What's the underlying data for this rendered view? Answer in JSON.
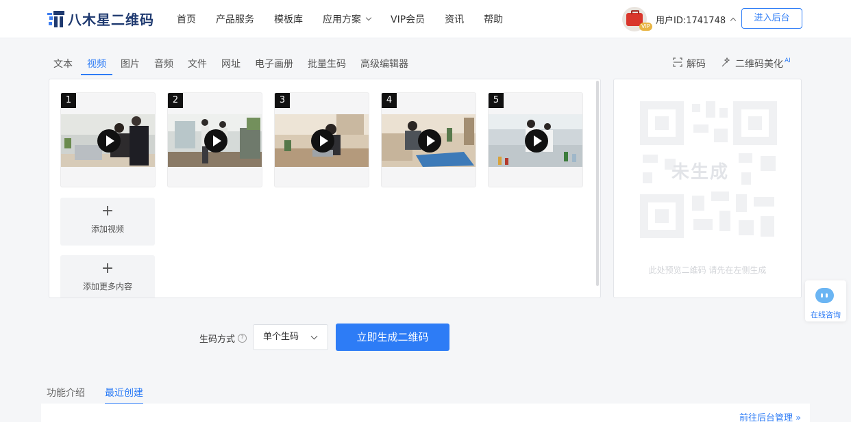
{
  "header": {
    "logo_text": "八木星二维码",
    "nav": [
      {
        "label": "首页"
      },
      {
        "label": "产品服务"
      },
      {
        "label": "模板库"
      },
      {
        "label": "应用方案",
        "has_dropdown": true
      },
      {
        "label": "VIP会员"
      },
      {
        "label": "资讯"
      },
      {
        "label": "帮助"
      }
    ],
    "user": {
      "vip_badge": "VIP",
      "id_text": "用户ID:1741748"
    },
    "enter_button": "进入后台"
  },
  "content_tabs": {
    "items": [
      "文本",
      "视频",
      "图片",
      "音频",
      "文件",
      "网址",
      "电子画册",
      "批量生码",
      "高级编辑器"
    ],
    "active": "视频"
  },
  "tools": {
    "decode_label": "解码",
    "beautify_label": "二维码美化",
    "beautify_badge": "AI"
  },
  "videos": [
    {
      "number": "1",
      "scene": "office-two-people-laptop"
    },
    {
      "number": "2",
      "scene": "office-walking"
    },
    {
      "number": "3",
      "scene": "sofa-laptop"
    },
    {
      "number": "4",
      "scene": "meeting-table"
    },
    {
      "number": "5",
      "scene": "laboratory"
    }
  ],
  "add_video_label": "添加视频",
  "add_more_label": "添加更多内容",
  "preview": {
    "status_text": "未生成",
    "hint": "此处预览二维码 请先在左侧生成"
  },
  "consult": {
    "label": "在线咨询"
  },
  "generate": {
    "mode_label": "生码方式",
    "help_icon": "?",
    "mode_value": "单个生码",
    "button": "立即生成二维码"
  },
  "bottom": {
    "tabs": [
      "功能介绍",
      "最近创建"
    ],
    "active": "最近创建",
    "manage_link": "前往后台管理 »"
  },
  "colors": {
    "accent": "#2d7cf6",
    "logo": "#1f3a70"
  }
}
